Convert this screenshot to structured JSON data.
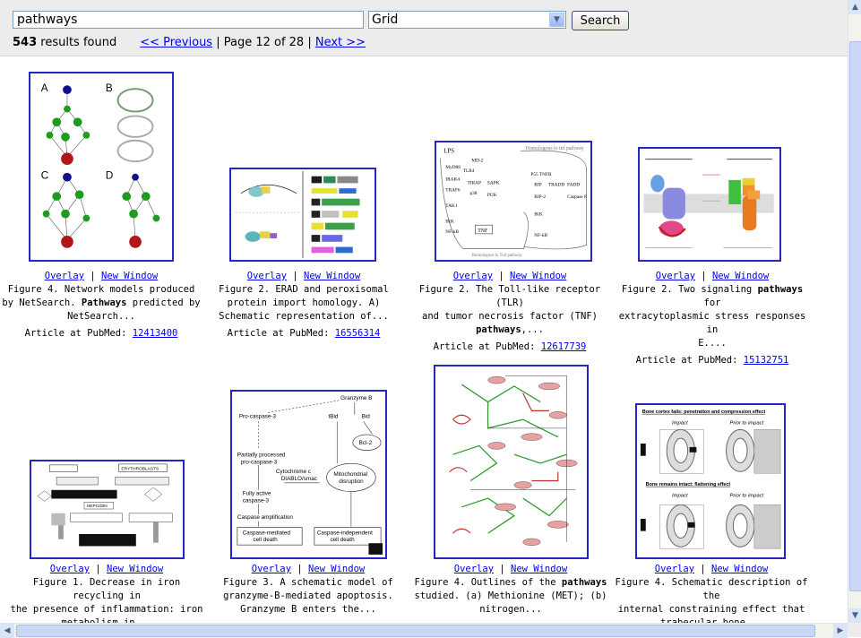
{
  "search": {
    "query": "pathways",
    "view_selected": "Grid",
    "button_label": "Search"
  },
  "status": {
    "count": "543",
    "count_suffix": " results found",
    "prev_label": "<< Previous",
    "page_text": " | Page 12 of 28 | ",
    "next_label": "Next >>"
  },
  "overlay_label": "Overlay",
  "separator": " | ",
  "new_window_label": "New Window",
  "pubmed_prefix": "Article at PubMed: ",
  "results": [
    {
      "lines": [
        [
          "Figure 4. Network models produced"
        ],
        [
          "by NetSearch. ",
          {
            "b": "Pathways"
          },
          " predicted by"
        ],
        [
          "NetSearch..."
        ]
      ],
      "pmid": "12413400",
      "labels": [
        "A",
        "B",
        "C",
        "D"
      ]
    },
    {
      "lines": [
        [
          "Figure 2. ERAD and peroxisomal"
        ],
        [
          "protein import homology. A)"
        ],
        [
          "Schematic representation of..."
        ]
      ],
      "pmid": "16556314"
    },
    {
      "lines": [
        [
          "Figure 2. The Toll-like receptor (TLR)"
        ],
        [
          "and tumor necrosis factor (TNF)"
        ],
        [
          {
            "b": "pathways"
          },
          ",..."
        ]
      ],
      "pmid": "12617739",
      "labels": [
        "Homologous to Toll pathway",
        "Homologous to tnf pathway",
        "LPS",
        "TNF",
        "SAPK",
        "IKK",
        "NF-kB",
        "Caspase 8"
      ]
    },
    {
      "lines": [
        [
          "Figure 2. Two signaling ",
          {
            "b": "pathways"
          },
          " for"
        ],
        [
          "extracytoplasmic stress responses in"
        ],
        [
          "E...."
        ]
      ],
      "pmid": "15132751"
    },
    {
      "lines": [
        [
          "Figure 1. Decrease in iron recycling in"
        ],
        [
          "the presence of inflammation: iron"
        ],
        [
          "metabolism in..."
        ]
      ],
      "labels": [
        "ERYTHROBLASTS",
        "HEPCIDIN"
      ]
    },
    {
      "lines": [
        [
          "Figure 3. A schematic model of"
        ],
        [
          "granzyme-B-mediated apoptosis."
        ],
        [
          "Granzyme B enters the..."
        ]
      ],
      "labels": [
        "Granzyme B",
        "Pro-caspase-3",
        "tBid",
        "Bid",
        "Bcl-2",
        "Partially processed",
        "pro-caspase-3",
        "Cytochrome c",
        "DIABLO/smac",
        "Mitochondrial",
        "disruption",
        "Fully active",
        "caspase-3",
        "Caspase amplification",
        "Caspase-mediated",
        "cell death",
        "Caspase-independent",
        "cell death"
      ]
    },
    {
      "lines": [
        [
          "Figure 4. Outlines of the ",
          {
            "b": "pathways"
          }
        ],
        [
          "studied. (a) Methionine (MET); (b)"
        ],
        [
          "nitrogen..."
        ]
      ]
    },
    {
      "lines": [
        [
          "Figure 4. Schematic description of the"
        ],
        [
          "internal constraining effect that"
        ],
        [
          "trabecular bone..."
        ]
      ],
      "labels": [
        "Bone cortex fails: penetration and compression effect",
        "Impact",
        "Prior to impact",
        "Bone remains intact: flattening effect",
        "Impact",
        "Prior to impact"
      ]
    }
  ]
}
